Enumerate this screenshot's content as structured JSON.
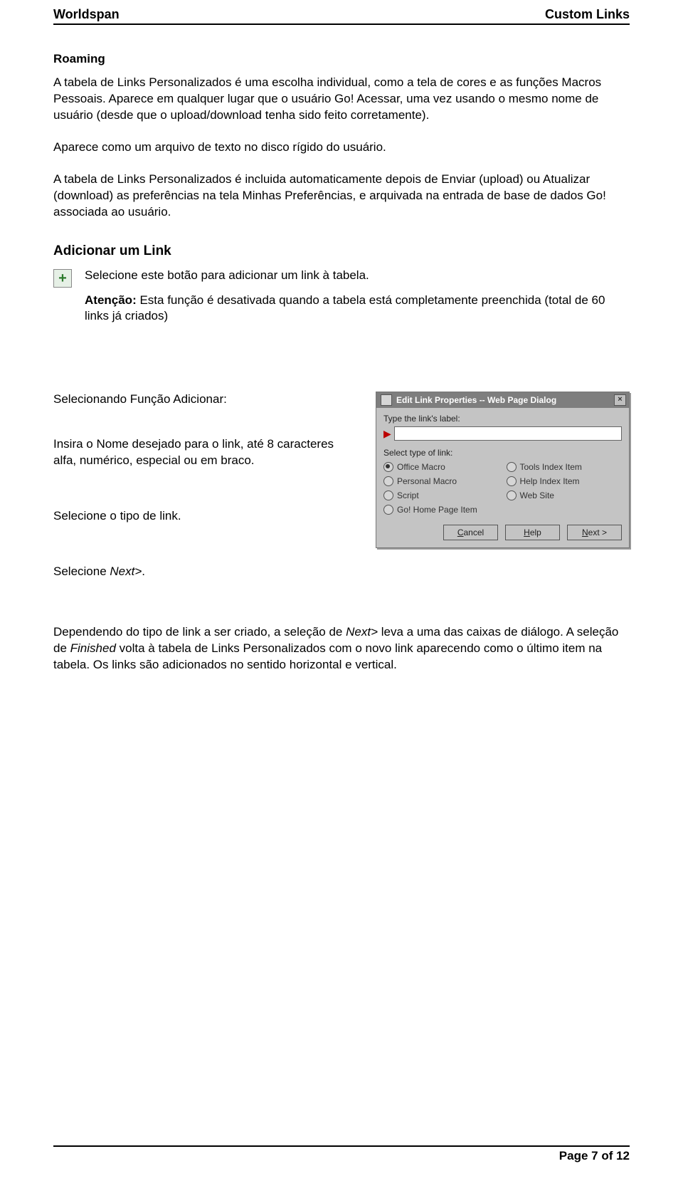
{
  "header": {
    "left": "Worldspan",
    "right": "Custom Links"
  },
  "roaming": {
    "title": "Roaming",
    "p1": "A tabela de Links Personalizados é uma escolha individual, como a tela de cores e as funções Macros Pessoais. Aparece em qualquer lugar que o usuário Go! Acessar, uma vez usando o mesmo nome de usuário (desde que o upload/download tenha sido feito corretamente).",
    "p2": "Aparece como um arquivo de texto no disco rígido do usuário.",
    "p3": "A tabela de Links Personalizados é incluida automaticamente depois de Enviar (upload) ou Atualizar (download) as preferências na tela Minhas Preferências, e arquivada na entrada de base de dados Go! associada ao usuário."
  },
  "addlink": {
    "title": "Adicionar um Link",
    "p1": "Selecione este botão para adicionar um link à tabela.",
    "atencao_label": "Atenção:",
    "atencao_text": " Esta função é desativada quando a tabela está completamente preenchida (total de 60 links já criados)"
  },
  "midsection": {
    "selecionando": "Selecionando Função Adicionar:",
    "insira": "Insira o Nome desejado para o link, até 8 caracteres alfa, numérico, especial ou em braco.",
    "tipo": "Selecione o tipo de link.",
    "next_prefix": "Selecione ",
    "next_italic": "Next>",
    "next_suffix": "."
  },
  "dialog": {
    "title": "Edit Link Properties -- Web Page Dialog",
    "type_label": "Type the link's label:",
    "select_type": "Select type of link:",
    "options": {
      "office_macro": "Office Macro",
      "personal_macro": "Personal Macro",
      "script": "Script",
      "go_home": "Go! Home Page Item",
      "tools_index": "Tools Index Item",
      "help_index": "Help Index Item",
      "web_site": "Web Site"
    },
    "btn_cancel": "Cancel",
    "btn_help": "Help",
    "btn_next": "Next >"
  },
  "bottom": {
    "p1a": "Dependendo do tipo de link a ser criado, a seleção de ",
    "p1_next": "Next>",
    "p1b": " leva a uma das caixas de diálogo. A seleção de ",
    "p1_finished": "Finished",
    "p1c": " volta à tabela de Links Personalizados com o novo link aparecendo como o último item na tabela. Os links são adicionados no sentido horizontal e vertical."
  },
  "footer": {
    "text": "Page 7 of 12"
  }
}
